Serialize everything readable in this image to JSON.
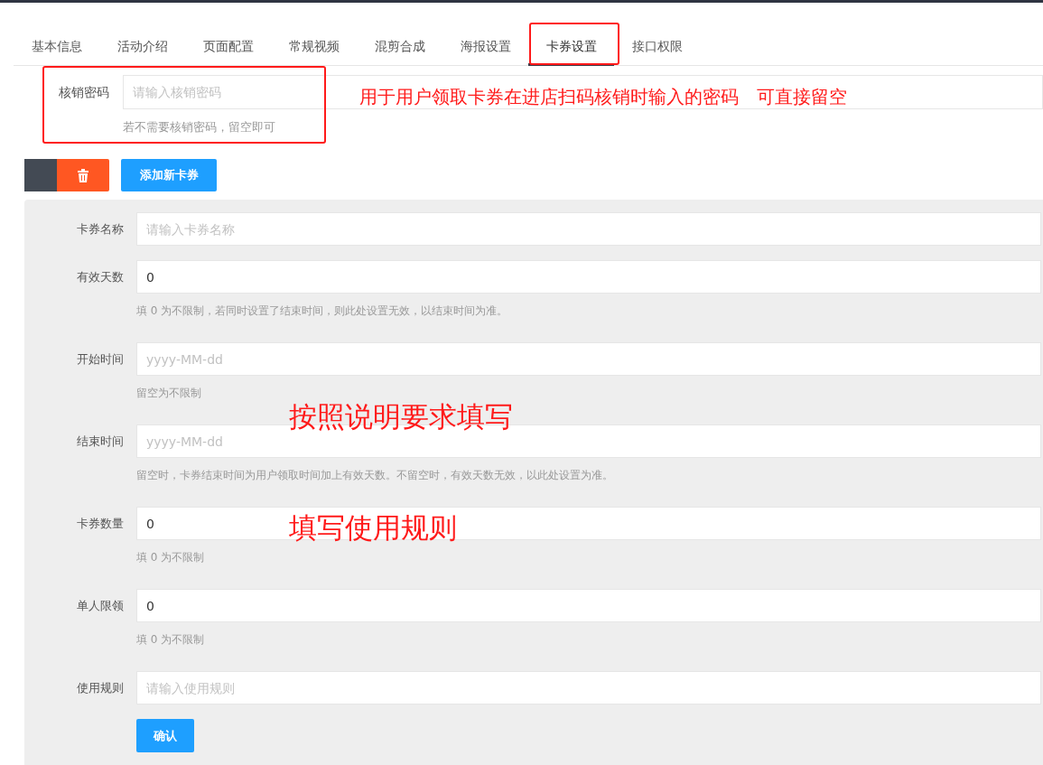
{
  "tabs": [
    {
      "label": "基本信息",
      "selected": false
    },
    {
      "label": "活动介绍",
      "selected": false
    },
    {
      "label": "页面配置",
      "selected": false
    },
    {
      "label": "常规视频",
      "selected": false
    },
    {
      "label": "混剪合成",
      "selected": false
    },
    {
      "label": "海报设置",
      "selected": false
    },
    {
      "label": "卡券设置",
      "selected": true
    },
    {
      "label": "接口权限",
      "selected": false
    }
  ],
  "password": {
    "label": "核销密码",
    "placeholder": "请输入核销密码",
    "help": "若不需要核销密码，留空即可"
  },
  "add_button": "添加新卡券",
  "coupon_form": {
    "fields": [
      {
        "label": "卡券名称",
        "placeholder": "请输入卡券名称"
      },
      {
        "label": "有效天数",
        "value": "0",
        "help": "填 0 为不限制，若同时设置了结束时间，则此处设置无效，以结束时间为准。"
      },
      {
        "label": "开始时间",
        "placeholder": "yyyy-MM-dd",
        "help": "留空为不限制"
      },
      {
        "label": "结束时间",
        "placeholder": "yyyy-MM-dd",
        "help": "留空时，卡券结束时间为用户领取时间加上有效天数。不留空时，有效天数无效，以此处设置为准。"
      },
      {
        "label": "卡券数量",
        "value": "0",
        "help": "填 0 为不限制"
      },
      {
        "label": "单人限领",
        "value": "0",
        "help": "填 0 为不限制"
      },
      {
        "label": "使用规则",
        "placeholder": "请输入使用规则"
      }
    ],
    "submit": "确认"
  },
  "annotations": [
    "用于用户领取卡券在进店扫码核销时输入的密码　可直接留空",
    "按照说明要求填写",
    "填写使用规则"
  ]
}
